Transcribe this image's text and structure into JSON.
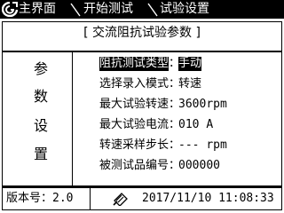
{
  "titlebar": {
    "breadcrumbs": [
      "主界面",
      "开始测试",
      "试验设置"
    ]
  },
  "panel": {
    "title": "[ 交流阻抗试验参数 ]",
    "side_label_chars": [
      "参",
      "数",
      "设",
      "置"
    ],
    "rows": [
      {
        "label": "阻抗测试类型",
        "value": "手动",
        "selected": true
      },
      {
        "label": "选择录入模式",
        "value": "转速",
        "selected": false
      },
      {
        "label": "最大试验转速",
        "value": "3600rpm",
        "selected": false
      },
      {
        "label": "最大试验电流",
        "value": "010 A",
        "selected": false
      },
      {
        "label": "转速采样步长",
        "value": "--- rpm",
        "selected": false
      },
      {
        "label": "被测试品编号",
        "value": "000000",
        "selected": false
      }
    ],
    "colon": "："
  },
  "statusbar": {
    "version_label": "版本号：",
    "version_value": "2.0",
    "datetime": "2017/11/10 11:08:33"
  },
  "icons": {
    "logo": "app-logo-icon",
    "separator": "breadcrumb-separator-icon",
    "usb": "usb-icon"
  }
}
